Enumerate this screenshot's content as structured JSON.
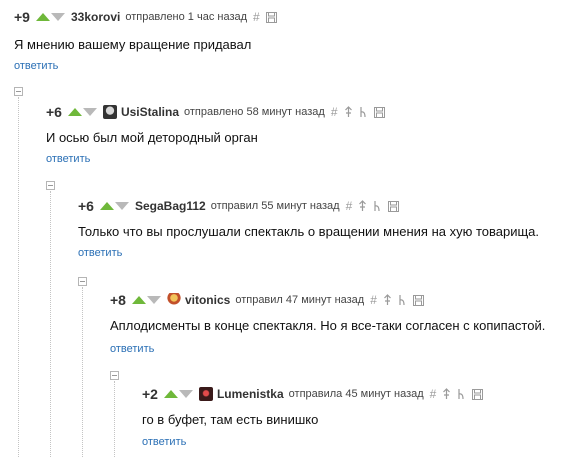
{
  "comments": [
    {
      "rating": "+9",
      "username": "33korovi",
      "status": "отправлено 1 час назад",
      "text": "Я мнению вашему вращение придавал",
      "reply": "ответить",
      "avatar": ""
    },
    {
      "rating": "+6",
      "username": "UsiStalina",
      "status": "отправлено 58 минут назад",
      "text": "И осью был мой детородный орган",
      "reply": "ответить",
      "avatar": "avatar-icon"
    },
    {
      "rating": "+6",
      "username": "SegaBag112",
      "status": "отправил 55 минут назад",
      "text": "Только что вы прослушали спектакль о вращении мнения на хую товарища.",
      "reply": "ответить",
      "avatar": ""
    },
    {
      "rating": "+8",
      "username": "vitonics",
      "status": "отправил 47 минут назад",
      "text": "Аплодисменты в конце спектакля. Но я все-таки согласен с копипастой.",
      "reply": "ответить",
      "avatar": "avatar-icon"
    },
    {
      "rating": "+2",
      "username": "Lumenistka",
      "status": "отправила 45 минут назад",
      "text": "го в буфет, там есть винишко",
      "reply": "ответить",
      "avatar": "avatar-icon"
    }
  ],
  "icons": {
    "anchor": "hash-icon",
    "parent": "arrow-up-icon",
    "thread": "branch-icon",
    "save": "floppy-icon"
  },
  "colors": {
    "vote_up": "#6fb83a",
    "vote_down": "#b9b9b9",
    "reply_link": "#2a6fb5"
  }
}
